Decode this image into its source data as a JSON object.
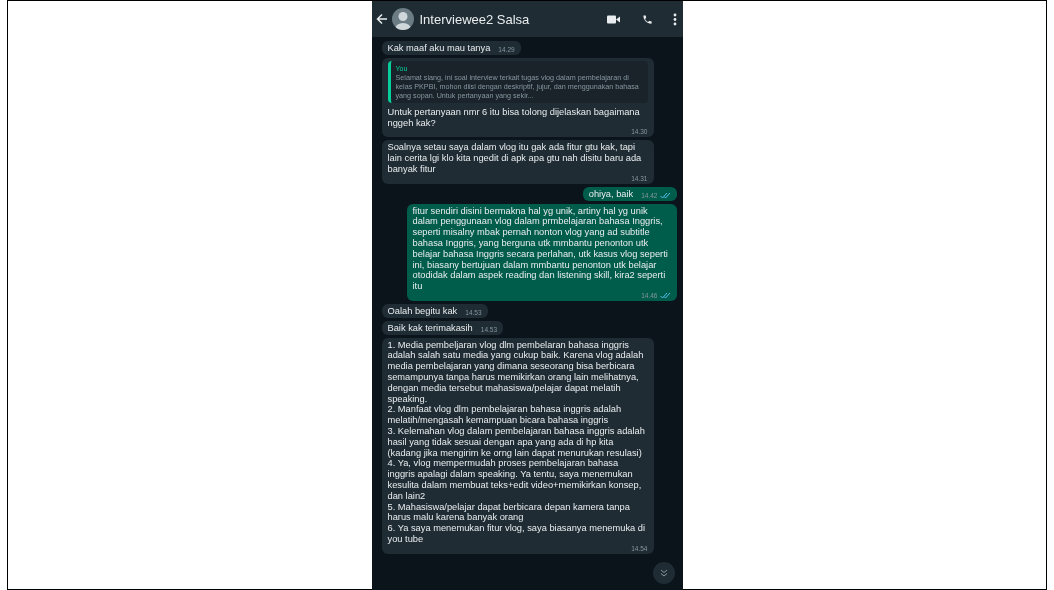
{
  "header": {
    "contact_name": "Interviewee2 Salsa"
  },
  "messages": [
    {
      "kind": "incoming",
      "text": "Kak maaf aku mau tanya",
      "time": "14.29"
    },
    {
      "kind": "incoming",
      "quote": {
        "author": "You",
        "text": "Selamat siang, ini soal interview terkait tugas vlog dalam pembelajaran di kelas PKPBI, mohon diisi dengan deskriptif, jujur, dan menggunakan bahasa yang sopan. Untuk pertanyaan yang sekir..."
      },
      "text": "Untuk pertanyaan nmr 6 itu bisa tolong dijelaskan bagaimana nggeh kak?",
      "time": "14.30"
    },
    {
      "kind": "incoming",
      "text": "Soalnya setau saya dalam vlog itu gak ada fitur gtu kak, tapi lain cerita lgi klo kita ngedit di apk apa gtu nah disitu baru ada banyak fitur",
      "time": "14.31"
    },
    {
      "kind": "outgoing",
      "text": "ohiya, baik",
      "time": "14.42"
    },
    {
      "kind": "outgoing",
      "text": "fitur sendiri disini bermakna hal yg unik, artiny hal yg unik dalam penggunaan vlog dalam prmbelajaran bahasa Inggris, seperti misalny mbak pernah nonton vlog yang ad subtitle bahasa Inggris, yang berguna utk mmbantu penonton utk belajar bahasa Inggris secara perlahan, utk kasus vlog seperti ini, biasany bertujuan dalam mmbantu penonton utk belajar otodidak dalam aspek reading dan listening skill, kira2 seperti itu",
      "time": "14.46"
    },
    {
      "kind": "incoming",
      "text": "Oalah begitu kak",
      "time": "14.53"
    },
    {
      "kind": "incoming",
      "text": "Baik kak terimakasih",
      "time": "14.53"
    },
    {
      "kind": "incoming",
      "text": "1. Media pembeljaran vlog dlm pembelaran bahasa inggris adalah salah satu media yang cukup baik. Karena vlog adalah media pembelajaran yang dimana seseorang bisa berbicara semampunya tanpa harus memikirkan orang lain melihatnya, dengan media tersebut mahasiswa/pelajar dapat melatih speaking.\n2. Manfaat vlog dlm pembelajaran bahasa inggris adalah melatih/mengasah kemampuan bicara bahasa inggris\n3. Kelemahan vlog dalam pembelajaran bahasa inggris adalah hasil yang tidak sesuai dengan apa yang ada di hp kita (kadang jika mengirim ke orng lain dapat menurukan resulasi)\n4. Ya, vlog mempermudah proses pembelajaran bahasa inggris apalagi dalam speaking. Ya tentu, saya menemukan kesulita dalam membuat teks+edit video+memikirkan konsep, dan lain2\n5. Mahasiswa/pelajar dapat berbicara depan kamera tanpa harus malu karena banyak orang\n6. Ya saya menemukan fitur vlog, saya biasanya menemuka di you tube",
      "time": "14.54"
    }
  ]
}
